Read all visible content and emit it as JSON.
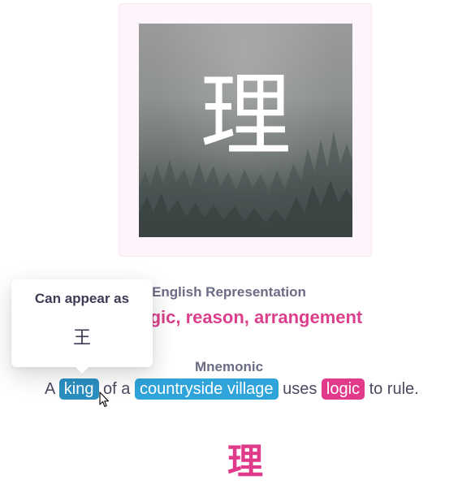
{
  "card": {
    "kanji": "理"
  },
  "english": {
    "label": "English Representation",
    "value": "Logic, reason, arrangement"
  },
  "mnemonic": {
    "label": "Mnemonic",
    "parts": {
      "t1": "A ",
      "chip1": "king",
      "t2": " of a ",
      "chip2": "countryside village",
      "t3": " uses ",
      "chip3": "logic",
      "t4": " to rule."
    }
  },
  "bottom": {
    "kanji": "理"
  },
  "tooltip": {
    "title": "Can appear as",
    "glyph": "王"
  },
  "colors": {
    "accent_pink": "#e03a8a",
    "radical_blue": "#2fa4da",
    "label_gray": "#6b6b85"
  },
  "icons": {
    "cursor": "pointer-cursor-icon"
  }
}
